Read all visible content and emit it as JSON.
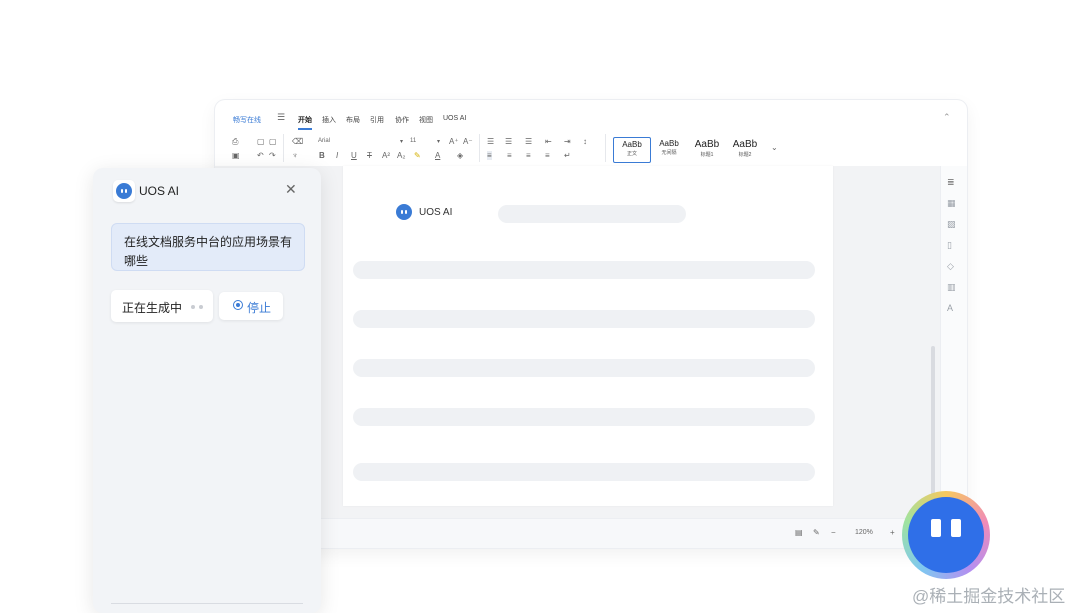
{
  "editor": {
    "brand": "畅写在线",
    "tabs": [
      "开始",
      "插入",
      "布局",
      "引用",
      "协作",
      "视图",
      "UOS AI"
    ],
    "active_tab": "开始",
    "toolbar": {
      "font_name": "Arial",
      "font_size": "11",
      "styles": [
        {
          "sample": "AaBb",
          "label": "正文"
        },
        {
          "sample": "AaBb",
          "label": "无间隔"
        },
        {
          "sample": "AaBb",
          "label": "标题1"
        },
        {
          "sample": "AaBb",
          "label": "标题2"
        }
      ]
    },
    "page": {
      "ai_label": "UOS AI"
    },
    "status": {
      "zoom": "120%",
      "minus": "−",
      "plus": "+"
    }
  },
  "ai_panel": {
    "title": "UOS AI",
    "question": "在线文档服务中台的应用场景有哪些",
    "generating_label": "正在生成中",
    "stop_label": "停止"
  },
  "watermark": "@稀土掘金技术社区",
  "colors": {
    "accent": "#3a7bd5",
    "fab": "#2f6fe8",
    "question_bg": "#e3ebf9"
  }
}
